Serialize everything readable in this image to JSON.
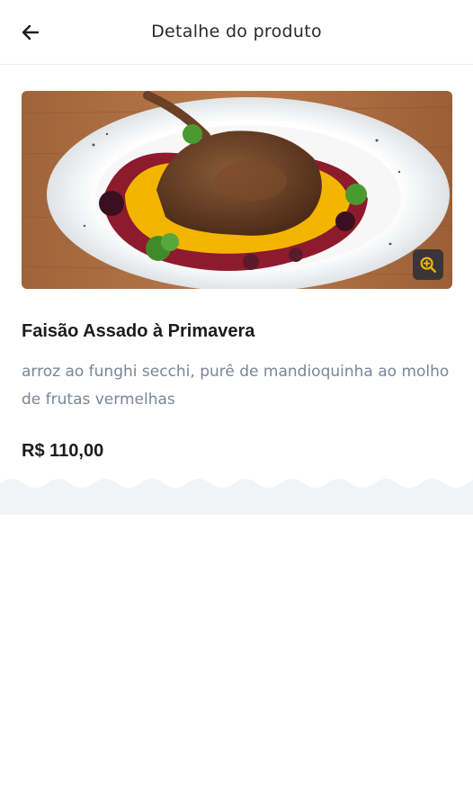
{
  "header": {
    "title": "Detalhe do produto",
    "back_icon": "arrow-left-icon"
  },
  "product": {
    "image_description_icon": "zoom-in-icon",
    "name": "Faisão Assado à Primavera",
    "description": "arroz ao funghi secchi, purê de mandioquinha ao molho de frutas vermelhas",
    "price": "R$ 110,00"
  },
  "colors": {
    "accent": "#f2b600",
    "description_text": "#7a8595",
    "wave_band": "#f2f3f4"
  }
}
